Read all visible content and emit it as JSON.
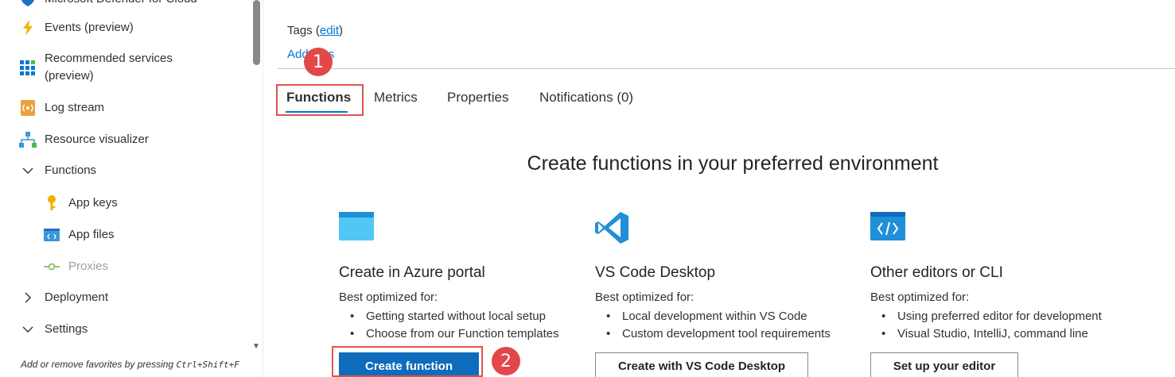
{
  "sidebar": {
    "items": [
      {
        "label": "Microsoft Defender for Cloud",
        "icon": "shield-icon"
      },
      {
        "label": "Events (preview)",
        "icon": "lightning-icon"
      },
      {
        "label": "Recommended services",
        "label2": "(preview)",
        "icon": "grid-icon"
      },
      {
        "label": "Log stream",
        "icon": "log-stream-icon"
      },
      {
        "label": "Resource visualizer",
        "icon": "hierarchy-icon"
      },
      {
        "label": "Functions",
        "icon": "chevron-down-icon"
      },
      {
        "label": "App keys",
        "icon": "key-icon"
      },
      {
        "label": "App files",
        "icon": "code-file-icon"
      },
      {
        "label": "Proxies",
        "icon": "proxy-icon"
      },
      {
        "label": "Deployment",
        "icon": "chevron-right-icon"
      },
      {
        "label": "Settings",
        "icon": "chevron-down-icon"
      }
    ],
    "footer_text": "Add or remove favorites by pressing",
    "footer_shortcut": "Ctrl+Shift+F"
  },
  "main": {
    "tags_label": "Tags (",
    "tags_edit": "edit",
    "tags_close": ")",
    "add_tags": "Add tags",
    "tabs": [
      "Functions",
      "Metrics",
      "Properties",
      "Notifications (0)"
    ],
    "heading": "Create functions in your preferred environment",
    "badges": [
      "1",
      "2"
    ],
    "cards": [
      {
        "title": "Create in Azure portal",
        "subtitle": "Best optimized for:",
        "bullets": [
          "Getting started without local setup",
          "Choose from our Function templates"
        ],
        "button": "Create function",
        "icon": "browser-window-icon"
      },
      {
        "title": "VS Code Desktop",
        "subtitle": "Best optimized for:",
        "bullets": [
          "Local development within VS Code",
          "Custom development tool requirements"
        ],
        "button": "Create with VS Code Desktop",
        "icon": "vscode-icon"
      },
      {
        "title": "Other editors or CLI",
        "subtitle": "Best optimized for:",
        "bullets": [
          "Using preferred editor for development",
          "Visual Studio, IntelliJ, command line"
        ],
        "button": "Set up your editor",
        "icon": "code-editor-icon"
      }
    ]
  },
  "colors": {
    "accent": "#0078d4",
    "primary_button": "#0f6cbd",
    "highlight": "#e05252",
    "badge": "#e2484a"
  }
}
